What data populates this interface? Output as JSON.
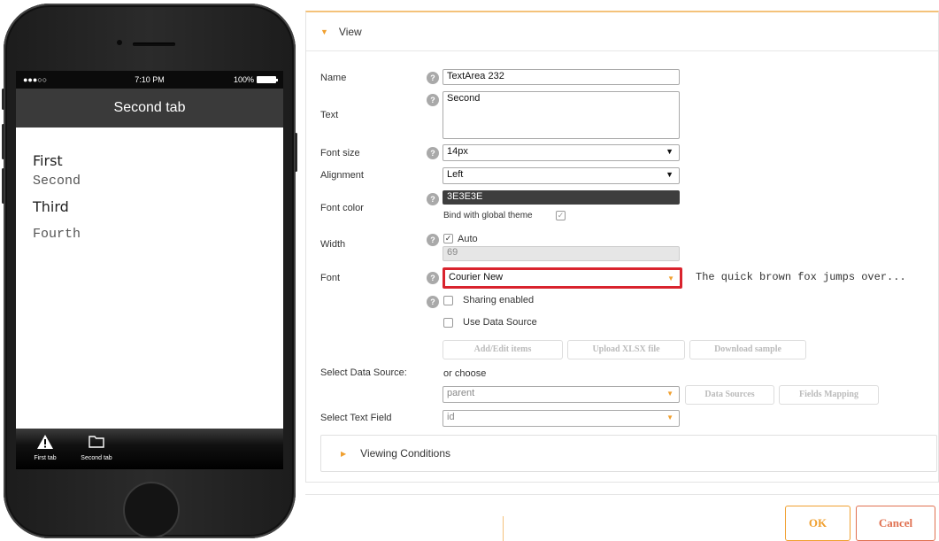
{
  "phone": {
    "status": {
      "signal": "●●●○○",
      "time": "7:10 PM",
      "battery": "100%"
    },
    "nav_title": "Second tab",
    "list": [
      "First",
      "Second",
      "Third",
      "Fourth"
    ],
    "tabs": [
      {
        "label": "First tab",
        "icon": "warning-icon"
      },
      {
        "label": "Second tab",
        "icon": "folder-icon"
      }
    ]
  },
  "panel": {
    "section_title": "View",
    "name_label": "Name",
    "name_value": "TextArea 232",
    "text_label": "Text",
    "text_value": "Second",
    "font_size_label": "Font size",
    "font_size_value": "14px",
    "alignment_label": "Alignment",
    "alignment_value": "Left",
    "font_color_label": "Font color",
    "font_color_value": "3E3E3E",
    "bind_theme_label": "Bind with global theme",
    "width_label": "Width",
    "width_auto_label": "Auto",
    "width_value": "69",
    "font_label": "Font",
    "font_value": "Courier New",
    "font_preview": "The quick brown fox jumps over...",
    "sharing_label": "Sharing enabled",
    "use_data_source_label": "Use Data Source",
    "add_edit_btn": "Add/Edit items",
    "upload_btn": "Upload XLSX file",
    "download_btn": "Download sample",
    "select_ds_label": "Select Data Source:",
    "or_choose": "or choose",
    "ds_value": "parent",
    "data_sources_btn": "Data Sources",
    "fields_mapping_btn": "Fields Mapping",
    "select_text_field_label": "Select Text Field",
    "text_field_value": "id",
    "viewing_conditions": "Viewing Conditions"
  },
  "footer": {
    "ok": "OK",
    "cancel": "Cancel"
  },
  "colors": {
    "accent": "#f0a030",
    "highlight": "#d9232d",
    "font_color_swatch": "#3E3E3E",
    "cancel": "#e07050"
  }
}
